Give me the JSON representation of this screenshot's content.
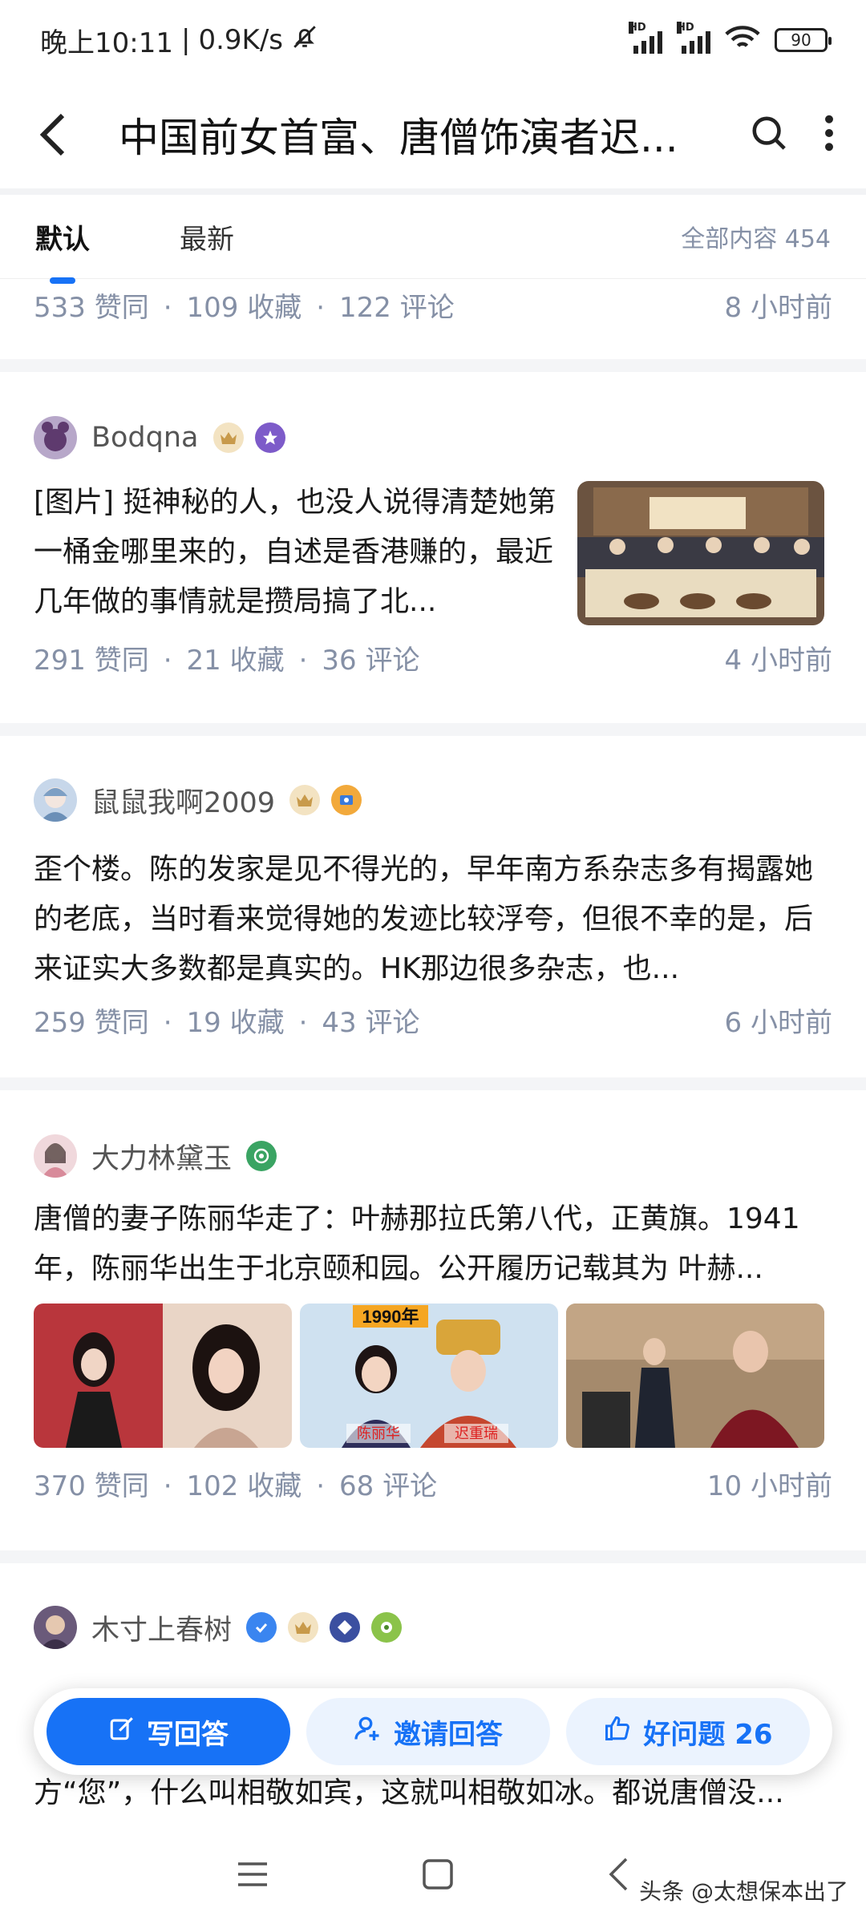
{
  "status_bar": {
    "time": "晚上10:11",
    "speed": "0.9K/s",
    "hd1": "HD",
    "hd2": "HD",
    "wifi_tag": "6",
    "battery": "90"
  },
  "header": {
    "title": "中国前女首富、唐僧饰演者迟..."
  },
  "tabs": {
    "items": [
      "默认",
      "最新"
    ],
    "count_label": "全部内容 454"
  },
  "answers": [
    {
      "stats": {
        "likes": "533 赞同",
        "favorites": "109 收藏",
        "comments": "122 评论",
        "time": "8 小时前"
      }
    },
    {
      "author": "Bodqna",
      "content": "[图片] 挺神秘的人，也没人说得清楚她第一桶金哪里来的，自述是香港赚的，最近几年做的事情就是攒局搞了北...",
      "stats": {
        "likes": "291 赞同",
        "favorites": "21 收藏",
        "comments": "36 评论",
        "time": "4 小时前"
      }
    },
    {
      "author": "鼠鼠我啊2009",
      "content": "歪个楼。陈的发家是见不得光的，早年南方系杂志多有揭露她的老底，当时看来觉得她的发迹比较浮夸，但很不幸的是，后来证实大多数都是真实的。HK那边很多杂志，也...",
      "stats": {
        "likes": "259 赞同",
        "favorites": "19 收藏",
        "comments": "43 评论",
        "time": "6 小时前"
      }
    },
    {
      "author": "大力林黛玉",
      "content": "唐僧的妻子陈丽华走了：叶赫那拉氏第八代，正黄旗。1941年，陈丽华出生于北京颐和园。公开履历记载其为 叶赫...",
      "image_caption": "1990年",
      "image_labels": [
        "陈丽华",
        "迟重瑞"
      ],
      "stats": {
        "likes": "370 赞同",
        "favorites": "102 收藏",
        "comments": "68 评论",
        "time": "10 小时前"
      }
    },
    {
      "author": "木寸上春树",
      "content_line1": "方“您”，什么叫相敬如宾，这就叫相敬如冰。都说唐僧没..."
    }
  ],
  "actions": {
    "write": "写回答",
    "invite": "邀请回答",
    "good_question": "好问题 26"
  },
  "watermark": "头条 @太想保本出了",
  "colors": {
    "accent": "#1772f6",
    "meta": "#8590a6"
  }
}
